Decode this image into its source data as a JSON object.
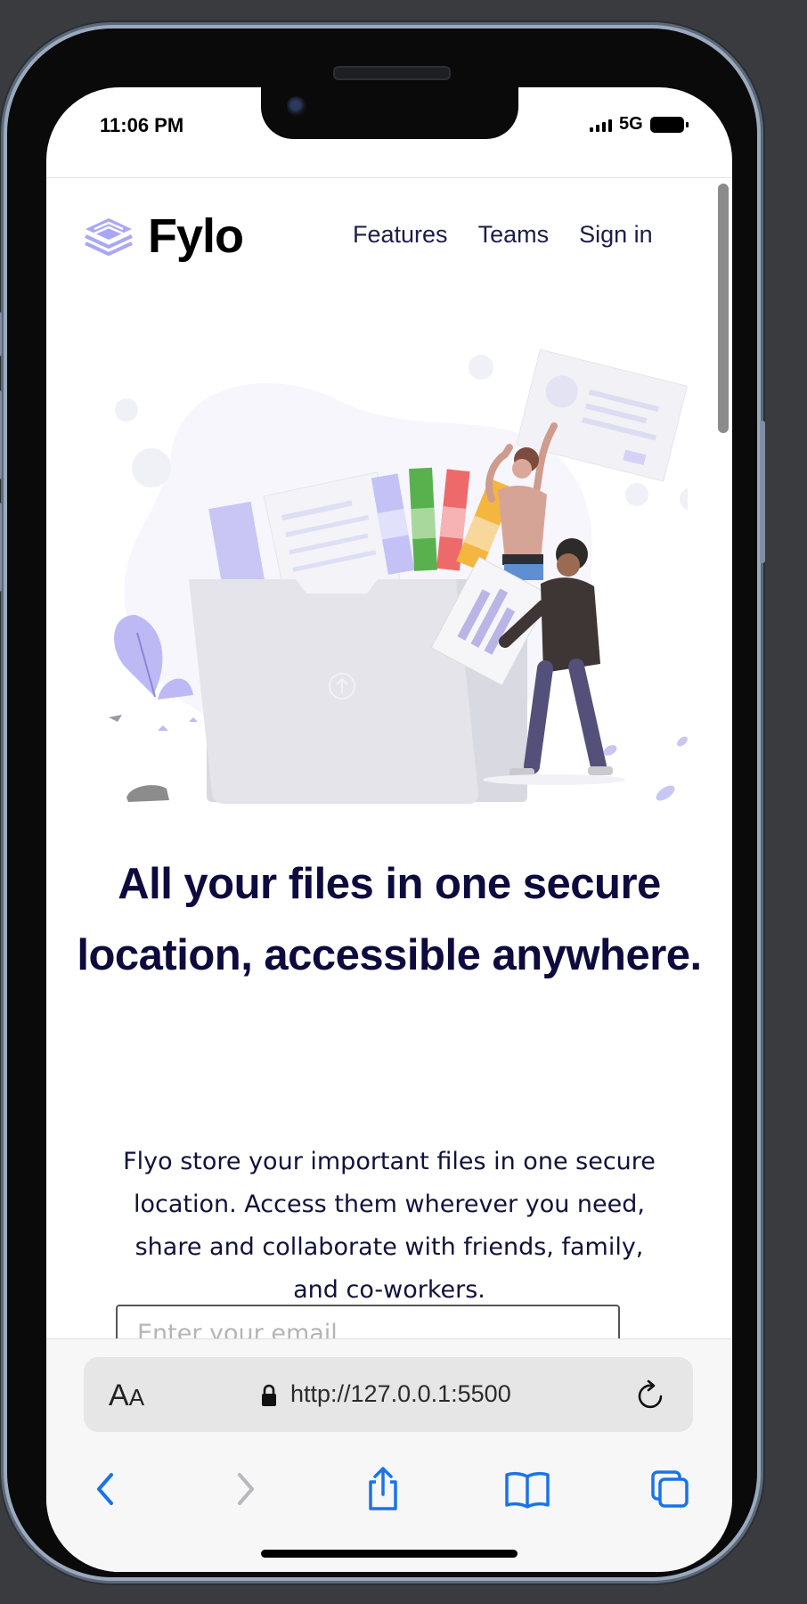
{
  "status_bar": {
    "time": "11:06 PM",
    "network": "5G"
  },
  "site": {
    "logo_text": "Fylo",
    "nav": [
      {
        "label": "Features"
      },
      {
        "label": "Teams"
      },
      {
        "label": "Sign in"
      }
    ],
    "hero": {
      "headline": "All your files in one secure location, accessible anywhere.",
      "subtext": "Flyo store your important files in one secure location. Access them wherever you need, share and collaborate with friends, family, and co-workers.",
      "email_placeholder": "Enter your email"
    }
  },
  "browser": {
    "text_size_label": "AA",
    "url": "http://127.0.0.1:5500"
  },
  "icons": {
    "logo": "stack-layers-icon",
    "lock": "lock-icon",
    "reload": "reload-icon",
    "back": "chevron-left-icon",
    "forward": "chevron-right-icon",
    "share": "share-icon",
    "bookmarks": "book-icon",
    "tabs": "tabs-icon"
  },
  "colors": {
    "headline": "#0d0b3d",
    "accent_purple": "#a9a7f5",
    "ios_blue": "#1a73e8"
  }
}
